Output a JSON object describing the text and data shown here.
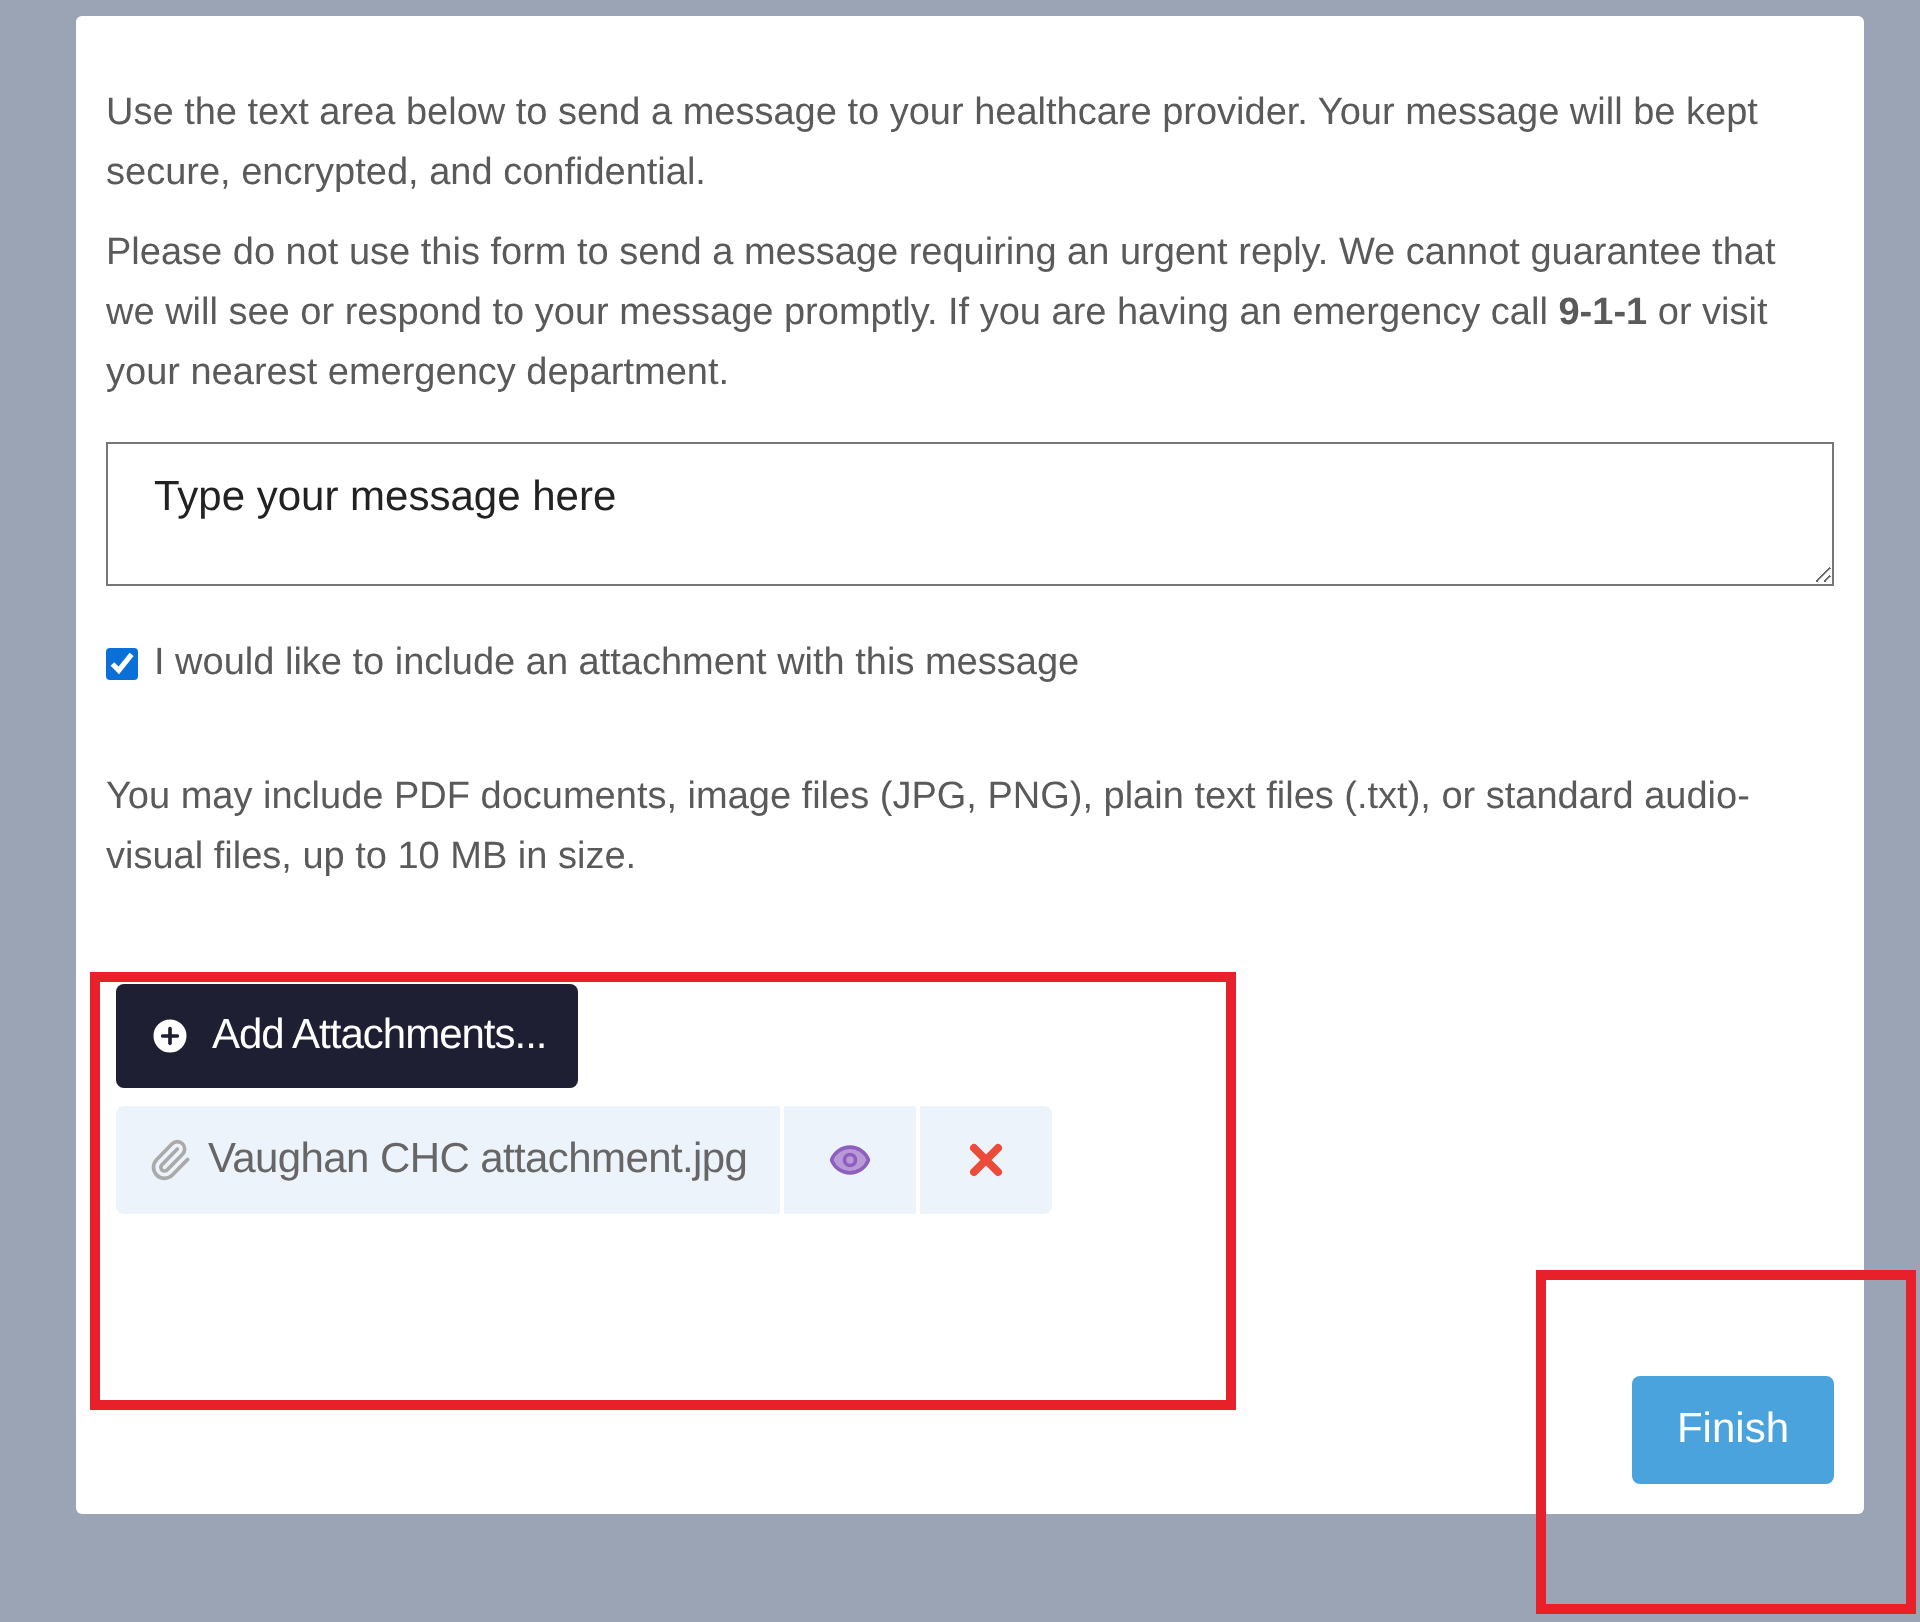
{
  "intro": "Use the text area below to send a message to your healthcare provider. Your message will be kept secure, encrypted, and confidential.",
  "warning": "Please do not use this form to send a message requiring an urgent reply. We cannot guarantee that we will see or respond to your message promptly. If you are having an emergency call **9-1-1** or visit your nearest emergency department.",
  "message": {
    "placeholder": "Type your message here"
  },
  "attachment_option": {
    "label": "I would like to include an attachment with this message",
    "checked": true
  },
  "file_note": "You may include PDF documents, image files (JPG, PNG), plain text files (.txt), or standard audio-visual files, up to 10 MB in size.",
  "attachments": {
    "highlighted": true,
    "add_button": "Add Attachments...",
    "files": [
      {
        "name": "Vaughan CHC attachment.jpg"
      }
    ]
  },
  "finish_button": {
    "label": "Finish",
    "highlighted": true
  }
}
